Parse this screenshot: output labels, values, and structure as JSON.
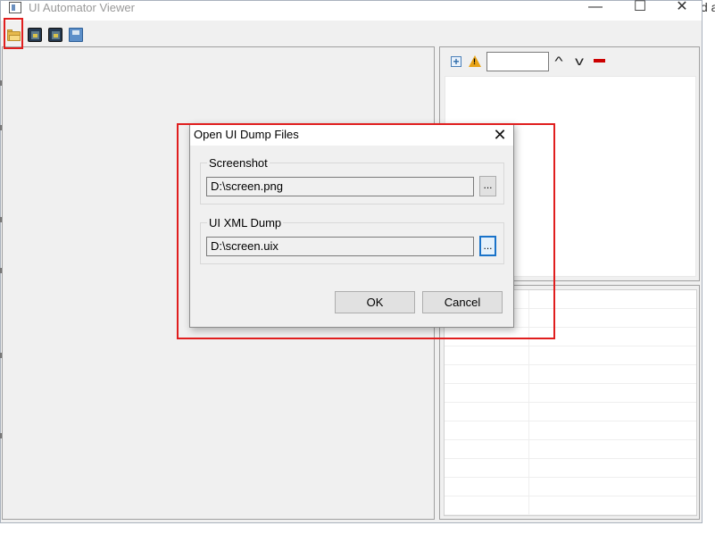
{
  "window": {
    "title": "UI Automator Viewer",
    "controls": {
      "minimize": "—",
      "maximize": "☐",
      "close": "✕"
    }
  },
  "background_window": {
    "partial_text": "d a"
  },
  "toolbar": {
    "items": [
      {
        "name": "open-button",
        "icon": "folder-open-icon"
      },
      {
        "name": "device-screenshot-button",
        "icon": "device-screenshot-icon"
      },
      {
        "name": "device-screenshot-compressed-button",
        "icon": "device-screenshot-compressed-icon"
      },
      {
        "name": "save-button",
        "icon": "save-icon"
      }
    ]
  },
  "hierarchy": {
    "search_value": "",
    "icons": {
      "expand": "+",
      "warning": "!",
      "prev": "^",
      "next": "v"
    }
  },
  "dialog": {
    "title": "Open UI Dump Files",
    "close": "✕",
    "screenshot_group": {
      "label": "Screenshot",
      "path": "D:\\screen.png",
      "browse": "..."
    },
    "dump_group": {
      "label": "UI XML Dump",
      "path": "D:\\screen.uix",
      "browse": "..."
    },
    "ok": "OK",
    "cancel": "Cancel"
  },
  "colors": {
    "highlight": "#e01e1e",
    "focus": "#1a73c9",
    "window_bg": "#f0f0f0"
  }
}
